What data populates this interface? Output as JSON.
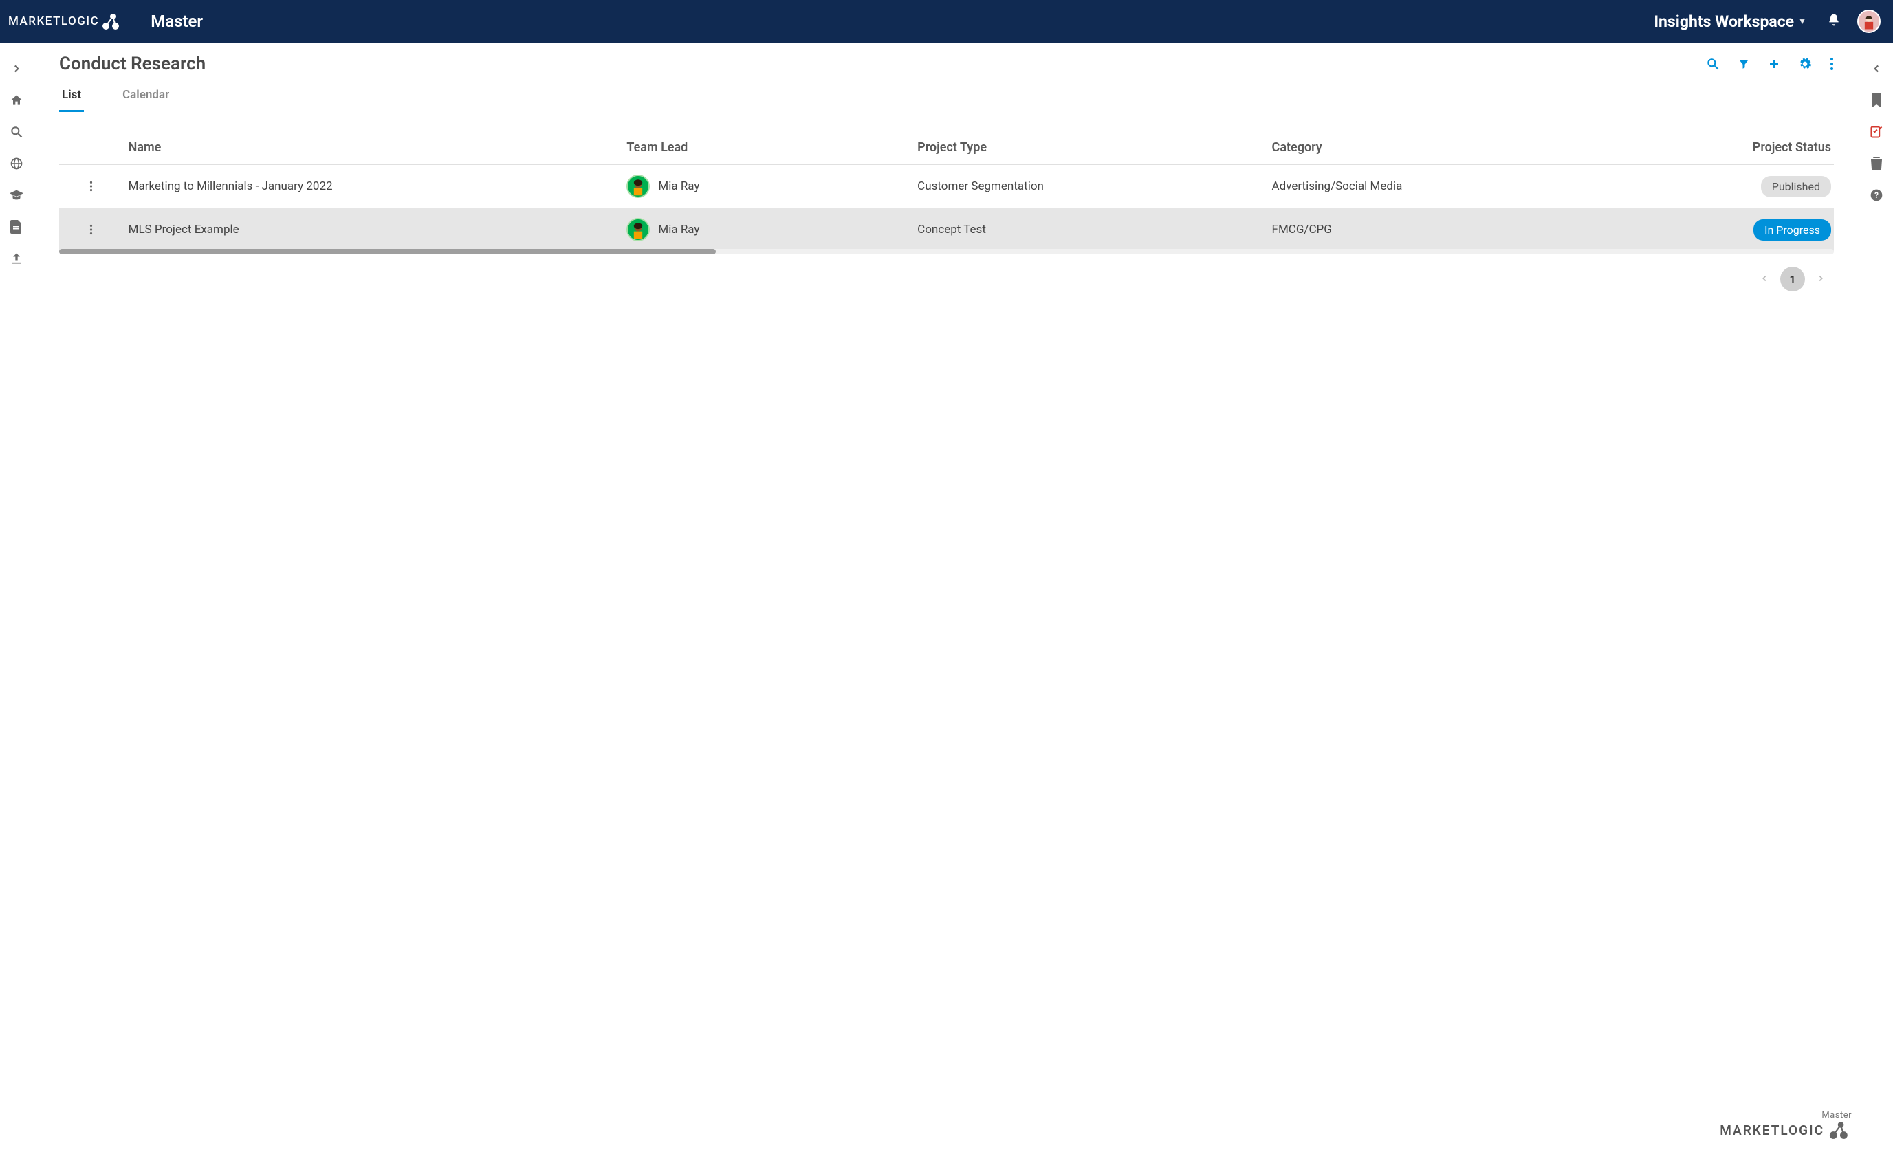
{
  "header": {
    "brand_text": "MARKETLOGIC",
    "tenant": "Master",
    "workspace": "Insights Workspace"
  },
  "page": {
    "title": "Conduct Research",
    "tabs": [
      {
        "label": "List",
        "active": true
      },
      {
        "label": "Calendar",
        "active": false
      }
    ]
  },
  "table": {
    "columns": [
      {
        "label": "Name"
      },
      {
        "label": "Team Lead"
      },
      {
        "label": "Project Type"
      },
      {
        "label": "Category"
      },
      {
        "label": "Project Status"
      }
    ],
    "rows": [
      {
        "name": "Marketing to Millennials - January 2022",
        "team_lead": "Mia Ray",
        "project_type": "Customer Segmentation",
        "category": "Advertising/Social Media",
        "status_label": "Published",
        "status_kind": "published"
      },
      {
        "name": "MLS Project Example",
        "team_lead": "Mia Ray",
        "project_type": "Concept Test",
        "category": "FMCG/CPG",
        "status_label": "In Progress",
        "status_kind": "inprogress",
        "hovered": true
      }
    ]
  },
  "pagination": {
    "current": "1"
  },
  "footer": {
    "sub": "Master",
    "brand": "MARKETLOGIC"
  },
  "colors": {
    "brand_navy": "#102a52",
    "accent_blue": "#0091da",
    "status_published_bg": "#e0e0e0",
    "status_inprogress_bg": "#0091da"
  }
}
